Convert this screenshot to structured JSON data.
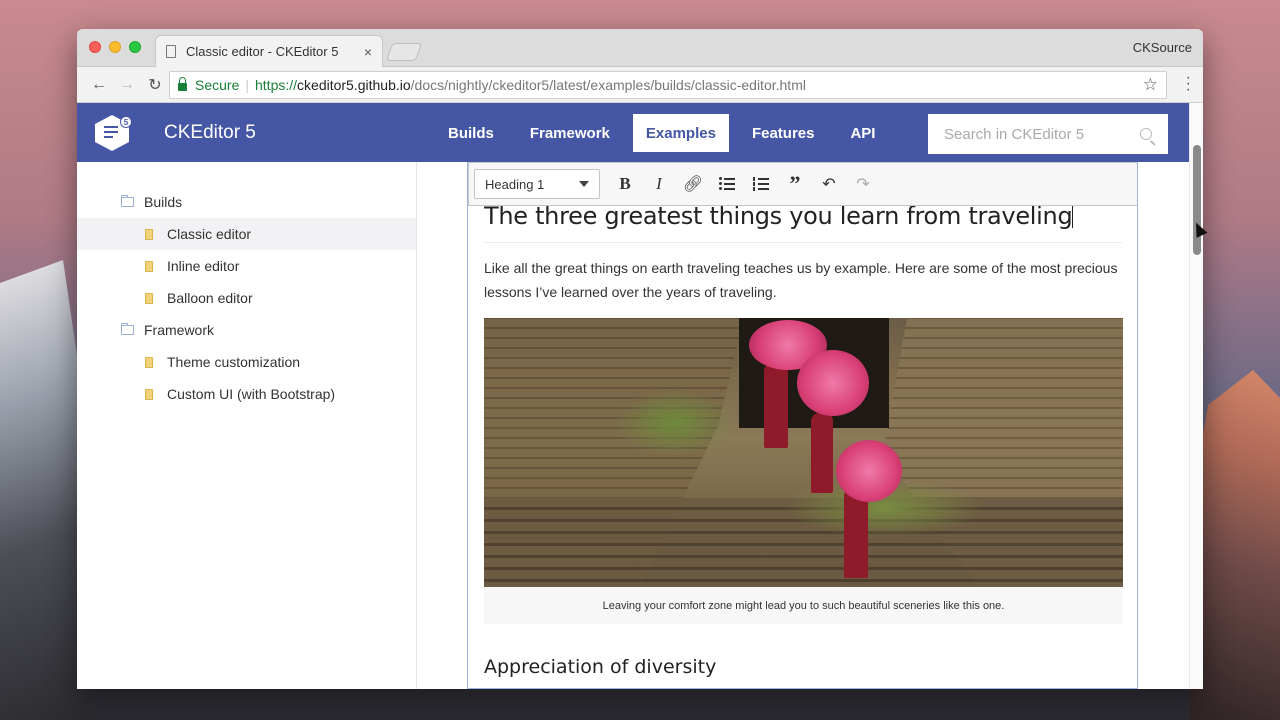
{
  "browser": {
    "tab_title": "Classic editor - CKEditor 5",
    "tab_close": "×",
    "profile": "CKSource",
    "security_label": "Secure",
    "url_scheme": "https://",
    "url_host": "ckeditor5.github.io",
    "url_path": "/docs/nightly/ckeditor5/latest/examples/builds/classic-editor.html"
  },
  "site": {
    "brand": "CKEditor 5",
    "logo_badge": "5",
    "nav": [
      "Builds",
      "Framework",
      "Examples",
      "Features",
      "API"
    ],
    "active_nav": "Examples",
    "search_placeholder": "Search in CKEditor 5"
  },
  "sidebar": {
    "items": [
      {
        "label": "Builds",
        "level": 0,
        "icon": "folder-icon"
      },
      {
        "label": "Classic editor",
        "level": 1,
        "icon": "file-icon",
        "selected": true
      },
      {
        "label": "Inline editor",
        "level": 1,
        "icon": "file-icon"
      },
      {
        "label": "Balloon editor",
        "level": 1,
        "icon": "file-icon"
      },
      {
        "label": "Framework",
        "level": 0,
        "icon": "folder-icon"
      },
      {
        "label": "Theme customization",
        "level": 1,
        "icon": "file-icon"
      },
      {
        "label": "Custom UI (with Bootstrap)",
        "level": 1,
        "icon": "file-icon"
      }
    ]
  },
  "editor": {
    "heading_select": "Heading 1",
    "bold_label": "B",
    "italic_label": "I",
    "h1": "The three greatest things you learn from traveling",
    "paragraph": "Like all the great things on earth traveling teaches us by example. Here are some of the most precious lessons I’ve learned over the years of traveling.",
    "caption": "Leaving your comfort zone might lead you to such beautiful sceneries like this one.",
    "h2": "Appreciation of diversity"
  },
  "colors": {
    "header_bg": "#4557a4",
    "secure_green": "#188038"
  }
}
